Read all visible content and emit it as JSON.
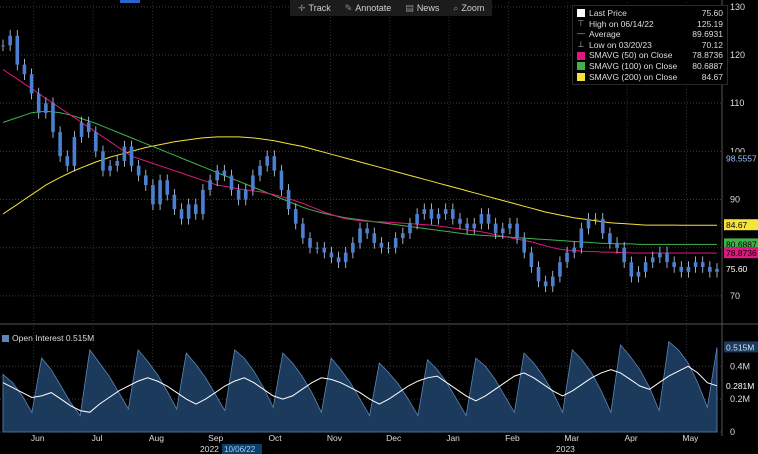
{
  "toolbar": {
    "track": "Track",
    "annotate": "Annotate",
    "news": "News",
    "zoom": "Zoom"
  },
  "legend": {
    "items": [
      {
        "label": "Last Price",
        "value": "75.60",
        "color": "#ffffff",
        "glyph": "swatch"
      },
      {
        "label": "High on 06/14/22",
        "value": "125.19",
        "glyph": "high-marker"
      },
      {
        "label": "Average",
        "value": "89.6931",
        "glyph": "average-marker"
      },
      {
        "label": "Low on 03/20/23",
        "value": "70.12",
        "glyph": "low-marker"
      },
      {
        "label": "SMAVG (50)  on Close",
        "value": "78.8736",
        "color": "#e0177f",
        "glyph": "swatch"
      },
      {
        "label": "SMAVG (100)  on Close",
        "value": "80.6887",
        "color": "#3fb24a",
        "glyph": "swatch"
      },
      {
        "label": "SMAVG (200)  on Close",
        "value": "84.67",
        "color": "#f5e23a",
        "glyph": "swatch"
      }
    ]
  },
  "open_interest": {
    "label": "Open Interest 0.515M"
  },
  "chart_data": [
    {
      "type": "line",
      "title": "",
      "x_axis": {
        "month_labels": [
          "Jun",
          "Jul",
          "Aug",
          "Sep",
          "Oct",
          "Nov",
          "Dec",
          "Jan",
          "Feb",
          "Mar",
          "Apr",
          "May"
        ],
        "year_labels": [
          {
            "after": "Sep",
            "text": "2022"
          },
          {
            "after": "Mar",
            "text": "2023"
          }
        ],
        "cursor_date": "10/06/22"
      },
      "y_axis": {
        "ticks": [
          70,
          80,
          90,
          100,
          110,
          120,
          130
        ],
        "range": [
          65,
          131
        ]
      },
      "series": [
        {
          "name": "Last Price",
          "color": "#4a7fd1",
          "values": [
            122,
            124,
            118,
            116,
            112,
            108,
            110,
            104,
            99,
            97,
            103,
            106,
            104,
            100,
            96,
            97,
            98,
            101,
            97,
            95,
            93,
            89,
            94,
            91,
            88,
            86,
            89,
            87,
            92,
            94,
            96,
            95,
            92,
            90,
            92,
            95,
            97,
            99,
            96,
            92,
            88,
            85,
            82,
            80,
            80,
            79,
            78,
            77,
            79,
            81,
            84,
            83,
            81,
            80,
            80,
            82,
            83,
            85,
            87,
            88,
            86,
            87,
            88,
            86,
            85,
            84,
            85,
            87,
            85,
            83,
            84,
            85,
            82,
            79,
            76,
            73,
            72,
            74,
            77,
            79,
            80,
            84,
            86,
            86,
            83,
            81,
            80,
            77,
            74,
            75,
            77,
            78,
            79,
            77,
            76,
            75,
            76,
            77,
            76,
            75,
            75.6
          ]
        },
        {
          "name": "SMAVG (50)  on Close",
          "color": "#e0177f",
          "values": [
            117,
            116,
            115,
            114,
            113,
            112,
            111,
            110,
            109,
            108,
            107,
            106,
            105,
            104,
            103,
            102,
            101,
            100,
            99,
            98.5,
            98,
            97.5,
            97,
            96.5,
            96,
            95.5,
            95,
            94.5,
            94,
            93.5,
            93,
            92.8,
            92.5,
            92.2,
            92,
            91.8,
            91.6,
            91.3,
            91,
            90.6,
            90.2,
            89.7,
            89.2,
            88.6,
            88,
            87.4,
            86.9,
            86.4,
            86,
            85.8,
            85.6,
            85.5,
            85.4,
            85.4,
            85.3,
            85.2,
            85.1,
            85,
            84.9,
            84.8,
            84.7,
            84.5,
            84.3,
            84.1,
            83.9,
            83.7,
            83.5,
            83.3,
            83,
            82.7,
            82.4,
            82.1,
            81.8,
            81.5,
            81.2,
            80.8,
            80.4,
            80,
            79.7,
            79.5,
            79.4,
            79.3,
            79.2,
            79.2,
            79.1,
            79.1,
            79,
            79,
            78.9,
            78.9,
            78.9,
            78.9,
            78.9,
            78.9,
            78.9,
            78.9,
            78.9,
            78.9,
            78.9,
            78.9,
            78.87
          ]
        },
        {
          "name": "SMAVG (100)  on Close",
          "color": "#3fb24a",
          "values": [
            106,
            106.5,
            107,
            107.5,
            108,
            108.2,
            108.3,
            108.2,
            108,
            107.7,
            107.3,
            106.8,
            106.3,
            105.8,
            105.2,
            104.6,
            104,
            103.4,
            102.8,
            102.2,
            101.6,
            101,
            100.4,
            99.8,
            99.2,
            98.6,
            98,
            97.4,
            96.8,
            96.2,
            95.6,
            95,
            94.4,
            93.8,
            93.2,
            92.6,
            92,
            91.4,
            90.8,
            90.2,
            89.6,
            89,
            88.4,
            87.9,
            87.5,
            87.1,
            86.8,
            86.5,
            86.2,
            86,
            85.8,
            85.6,
            85.4,
            85.2,
            85,
            84.8,
            84.6,
            84.4,
            84.2,
            84,
            83.8,
            83.6,
            83.4,
            83.2,
            83,
            82.8,
            82.7,
            82.6,
            82.5,
            82.4,
            82.3,
            82.2,
            82.1,
            82,
            81.9,
            81.8,
            81.7,
            81.6,
            81.5,
            81.4,
            81.3,
            81.2,
            81.1,
            81,
            80.9,
            80.9,
            80.8,
            80.8,
            80.8,
            80.7,
            80.7,
            80.7,
            80.7,
            80.7,
            80.7,
            80.7,
            80.7,
            80.7,
            80.7,
            80.7,
            80.69
          ]
        },
        {
          "name": "SMAVG (200)  on Close",
          "color": "#f5e23a",
          "values": [
            87,
            88,
            89,
            90,
            91,
            92,
            93,
            93.8,
            94.6,
            95.3,
            96,
            96.6,
            97.2,
            97.8,
            98.3,
            98.8,
            99.2,
            99.6,
            100,
            100.4,
            100.8,
            101.1,
            101.4,
            101.7,
            102,
            102.2,
            102.4,
            102.6,
            102.8,
            102.9,
            103,
            103,
            103,
            103,
            102.9,
            102.8,
            102.6,
            102.4,
            102.2,
            101.9,
            101.6,
            101.3,
            101,
            100.6,
            100.2,
            99.8,
            99.4,
            99,
            98.6,
            98.2,
            97.8,
            97.4,
            97,
            96.6,
            96.2,
            95.8,
            95.4,
            95,
            94.6,
            94.2,
            93.8,
            93.4,
            93,
            92.6,
            92.2,
            91.8,
            91.4,
            91,
            90.6,
            90.2,
            89.8,
            89.4,
            89,
            88.6,
            88.2,
            87.8,
            87.4,
            87.1,
            86.8,
            86.5,
            86.2,
            86,
            85.8,
            85.6,
            85.4,
            85.2,
            85.1,
            85,
            84.9,
            84.8,
            84.7,
            84.7,
            84.7,
            84.7,
            84.7,
            84.67,
            84.67,
            84.67,
            84.67,
            84.67,
            84.67
          ]
        }
      ],
      "value_labels": [
        {
          "text": "98.5557",
          "y": 98.56,
          "bg": "#000000",
          "fg": "#9fc3ff"
        },
        {
          "text": "84.67",
          "y": 84.67,
          "bg": "#f5e23a",
          "fg": "#000000"
        },
        {
          "text": "80.6887",
          "y": 80.69,
          "bg": "#3fb24a",
          "fg": "#000000"
        },
        {
          "text": "78.8736",
          "y": 78.87,
          "bg": "#e0177f",
          "fg": "#000000"
        },
        {
          "text": "75.60",
          "y": 75.6,
          "bg": "#000000",
          "fg": "#ffffff"
        }
      ]
    },
    {
      "type": "area",
      "title": "Open Interest 0.515M",
      "y_axis": {
        "ticks": [
          "0",
          "0.2M",
          "0.4M"
        ],
        "range": [
          0,
          0.56
        ]
      },
      "series": [
        {
          "name": "Open Interest",
          "color": "#1b3a5c",
          "values": [
            0.35,
            0.3,
            0.22,
            0.12,
            0.45,
            0.38,
            0.28,
            0.18,
            0.1,
            0.5,
            0.42,
            0.34,
            0.24,
            0.14,
            0.5,
            0.43,
            0.35,
            0.25,
            0.14,
            0.48,
            0.41,
            0.33,
            0.23,
            0.13,
            0.5,
            0.45,
            0.37,
            0.27,
            0.15,
            0.48,
            0.42,
            0.34,
            0.24,
            0.12,
            0.45,
            0.38,
            0.3,
            0.2,
            0.1,
            0.42,
            0.36,
            0.29,
            0.2,
            0.1,
            0.44,
            0.38,
            0.3,
            0.2,
            0.1,
            0.45,
            0.4,
            0.32,
            0.22,
            0.12,
            0.48,
            0.42,
            0.34,
            0.24,
            0.12,
            0.5,
            0.44,
            0.36,
            0.25,
            0.12,
            0.53,
            0.46,
            0.38,
            0.27,
            0.13,
            0.55,
            0.5,
            0.42,
            0.3,
            0.15,
            0.515
          ]
        },
        {
          "name": "Total",
          "color": "#ffffff",
          "values": [
            0.3,
            0.27,
            0.24,
            0.21,
            0.22,
            0.24,
            0.2,
            0.16,
            0.13,
            0.12,
            0.17,
            0.21,
            0.25,
            0.28,
            0.31,
            0.33,
            0.31,
            0.28,
            0.24,
            0.2,
            0.17,
            0.2,
            0.24,
            0.28,
            0.31,
            0.33,
            0.3,
            0.26,
            0.22,
            0.2,
            0.22,
            0.26,
            0.3,
            0.33,
            0.32,
            0.3,
            0.27,
            0.24,
            0.2,
            0.17,
            0.2,
            0.24,
            0.28,
            0.31,
            0.33,
            0.34,
            0.3,
            0.26,
            0.22,
            0.19,
            0.22,
            0.26,
            0.3,
            0.34,
            0.36,
            0.33,
            0.29,
            0.25,
            0.22,
            0.25,
            0.29,
            0.33,
            0.36,
            0.38,
            0.36,
            0.32,
            0.28,
            0.26,
            0.3,
            0.34,
            0.37,
            0.4,
            0.36,
            0.3,
            0.281
          ]
        }
      ],
      "value_labels": [
        {
          "text": "0.515M",
          "y": 0.515,
          "bg": "#1b3a5c",
          "fg": "#cfe0f5"
        },
        {
          "text": "0.281M",
          "y": 0.281,
          "bg": "#000000",
          "fg": "#ffffff"
        }
      ]
    }
  ]
}
